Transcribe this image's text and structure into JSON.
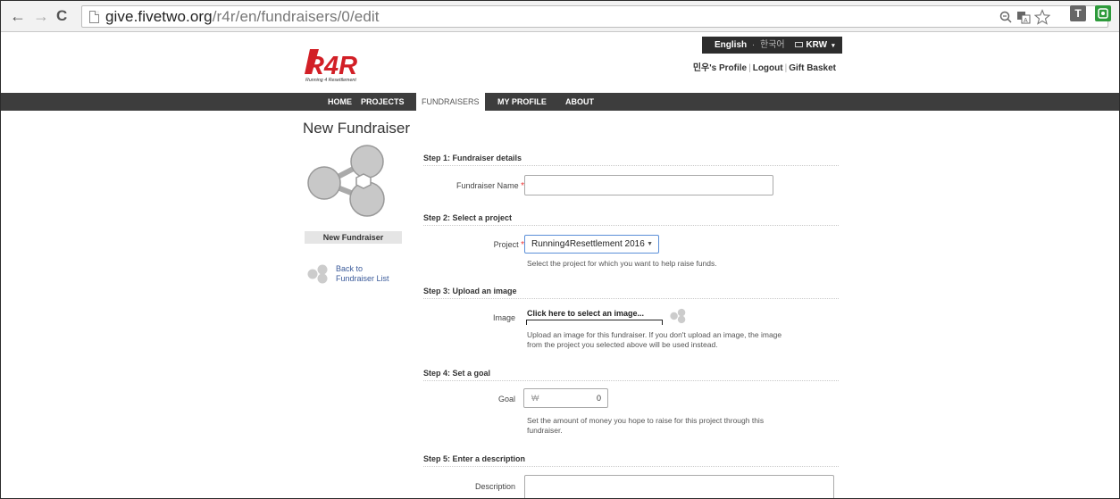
{
  "browser": {
    "back": "←",
    "forward": "→",
    "reload": "C",
    "url_host": "give.fivetwo.org",
    "url_path": "/r4r/en/fundraisers/0/edit",
    "ext_t": "T"
  },
  "header": {
    "lang_english": "English",
    "lang_dot": "·",
    "lang_korean": "한국어",
    "currency": "KRW",
    "profile_link": "민우's Profile",
    "logout_link": "Logout",
    "basket_link": "Gift Basket",
    "logo_text": "R4R",
    "logo_tagline": "Running 4 Resettlement"
  },
  "nav": {
    "home": "HOME",
    "projects": "PROJECTS",
    "fundraisers": "FUNDRAISERS",
    "my_profile": "MY PROFILE",
    "about": "ABOUT"
  },
  "sidebar": {
    "title": "New Fundraiser",
    "label": "New Fundraiser",
    "back_line1": "Back to",
    "back_line2": "Fundraiser List"
  },
  "form": {
    "step1": "Step 1: Fundraiser details",
    "name_label": "Fundraiser Name",
    "name_value": "",
    "step2": "Step 2: Select a project",
    "project_label": "Project",
    "project_value": "Running4Resettlement 2016",
    "project_help": "Select the project for which you want to help raise funds.",
    "step3": "Step 3: Upload an image",
    "image_label": "Image",
    "image_picker": "Click here to select an image...",
    "image_help_1": "Upload an image for this fundraiser. If you don't upload an image, the image",
    "image_help_2": "from the project you selected above will be used instead.",
    "step4": "Step 4: Set a goal",
    "goal_label": "Goal",
    "goal_currency": "₩",
    "goal_value": "0",
    "goal_help_1": "Set the amount of money you hope to raise for this project through this",
    "goal_help_2": "fundraiser.",
    "step5": "Step 5: Enter a description",
    "desc_label": "Description",
    "desc_value": ""
  },
  "colors": {
    "navbar": "#3d3d3d",
    "logo_red": "#d21f26",
    "link_blue": "#3a5a9a",
    "select_border": "#5b8fd8",
    "required": "#e33333"
  }
}
